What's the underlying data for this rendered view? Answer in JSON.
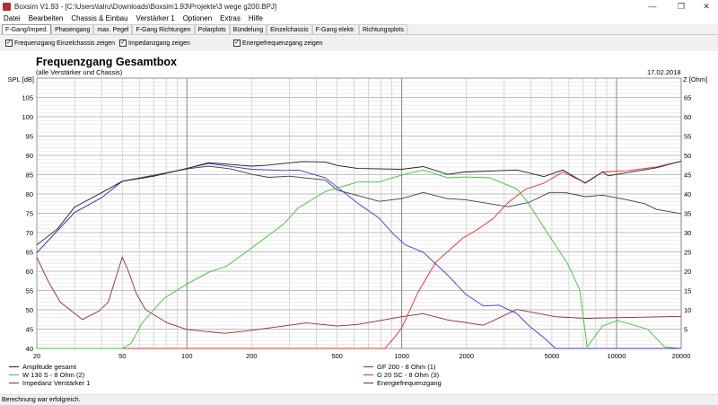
{
  "window": {
    "title": "Boxsim V1.93 - [C:\\Users\\talru\\Downloads\\Boxsim1.93\\Projekte\\3 wege g200.BPJ]",
    "minimize": "—",
    "restore": "❐",
    "close": "✕"
  },
  "menu": [
    "Datei",
    "Bearbeiten",
    "Chassis & Einbau",
    "Verstärker 1",
    "Optionen",
    "Extras",
    "Hilfe"
  ],
  "tabs": [
    "F-Gang/Imped.",
    "Phasengang",
    "max. Pegel",
    "F-Gang Richtungen",
    "Polarplots",
    "Bündelung",
    "Einzelchassis",
    "F-Gang elektr.",
    "Richtungsplots"
  ],
  "options": [
    {
      "label": "Frequenzgang Einzelchassis zeigen",
      "checked": true
    },
    {
      "label": "Impedanzgang zeigen",
      "checked": true
    },
    {
      "label": "Energiefrequenzgang zeigen",
      "checked": true
    }
  ],
  "status": "Berechnung war erfolgreich.",
  "chart_data": {
    "type": "line",
    "title": "Frequenzgang Gesamtbox",
    "subtitle": "(alle Verstärker und Chassis)",
    "date": "17.02.2018",
    "ylabel": "SPL [dB]",
    "y2label": "Z [Ohm]",
    "xscale": "log",
    "xlim": [
      20,
      20000
    ],
    "ylim": [
      40,
      110
    ],
    "y2lim": [
      0,
      70
    ],
    "xticks": [
      20,
      50,
      100,
      200,
      500,
      1000,
      2000,
      5000,
      10000,
      20000
    ],
    "yticks": [
      40,
      45,
      50,
      55,
      60,
      65,
      70,
      75,
      80,
      85,
      90,
      95,
      100,
      105
    ],
    "y2ticks": [
      5,
      10,
      15,
      20,
      25,
      30,
      35,
      40,
      45,
      50,
      55,
      60,
      65
    ],
    "grid": true,
    "legend_position": "bottom",
    "series": [
      {
        "name": "Amplitude gesamt",
        "color": "#202020",
        "axis": "spl",
        "points": [
          [
            20,
            66.8
          ],
          [
            25,
            71
          ],
          [
            30,
            76.6
          ],
          [
            40,
            80.3
          ],
          [
            50,
            83.3
          ],
          [
            70,
            84.6
          ],
          [
            100,
            86.6
          ],
          [
            126,
            88.1
          ],
          [
            200,
            87.2
          ],
          [
            240,
            87.5
          ],
          [
            341,
            88.4
          ],
          [
            440,
            88.3
          ],
          [
            500,
            87.4
          ],
          [
            624,
            86.6
          ],
          [
            1000,
            86.4
          ],
          [
            1260,
            87.1
          ],
          [
            1630,
            85.1
          ],
          [
            1980,
            85.7
          ],
          [
            3440,
            86.2
          ],
          [
            4590,
            84.5
          ],
          [
            5620,
            86.2
          ],
          [
            7150,
            82.8
          ],
          [
            8600,
            85.7
          ],
          [
            9170,
            84.7
          ],
          [
            15350,
            86.8
          ],
          [
            20000,
            88.5
          ]
        ]
      },
      {
        "name": "GF 200 - 8 Ohm (1)",
        "color": "#3a3ad8",
        "axis": "spl",
        "points": [
          [
            20,
            64.8
          ],
          [
            30,
            75.2
          ],
          [
            40,
            79
          ],
          [
            50,
            83.3
          ],
          [
            70,
            84.6
          ],
          [
            100,
            86.6
          ],
          [
            126,
            87.9
          ],
          [
            200,
            86.4
          ],
          [
            282,
            86.1
          ],
          [
            330,
            86.2
          ],
          [
            440,
            84.2
          ],
          [
            624,
            77.6
          ],
          [
            783,
            73.8
          ],
          [
            918,
            69.5
          ],
          [
            1040,
            66.8
          ],
          [
            1260,
            64.9
          ],
          [
            1630,
            59.1
          ],
          [
            1980,
            54.1
          ],
          [
            2400,
            51
          ],
          [
            2840,
            51.2
          ],
          [
            3440,
            49
          ],
          [
            3900,
            45.9
          ],
          [
            4590,
            42.8
          ],
          [
            5200,
            40
          ],
          [
            20000,
            40
          ]
        ]
      },
      {
        "name": "W 130 S - 8 Ohm (2)",
        "color": "#40c040",
        "axis": "spl",
        "points": [
          [
            20,
            40
          ],
          [
            50,
            40
          ],
          [
            55,
            41.3
          ],
          [
            62,
            46.7
          ],
          [
            78,
            52.9
          ],
          [
            100,
            56.7
          ],
          [
            126,
            59.7
          ],
          [
            153,
            61.3
          ],
          [
            200,
            66
          ],
          [
            282,
            72.2
          ],
          [
            330,
            76.4
          ],
          [
            440,
            80.6
          ],
          [
            624,
            83.1
          ],
          [
            783,
            83.1
          ],
          [
            1000,
            84.9
          ],
          [
            1260,
            86.2
          ],
          [
            1630,
            84.2
          ],
          [
            1980,
            84.4
          ],
          [
            2570,
            84.2
          ],
          [
            3440,
            81.3
          ],
          [
            3900,
            77.5
          ],
          [
            4590,
            71.3
          ],
          [
            5900,
            62.1
          ],
          [
            6740,
            55.2
          ],
          [
            7300,
            40.4
          ],
          [
            8600,
            45.8
          ],
          [
            10100,
            47.2
          ],
          [
            13940,
            45
          ],
          [
            16700,
            40.4
          ],
          [
            20000,
            40
          ]
        ]
      },
      {
        "name": "G 20 SC - 8 Ohm (3)",
        "color": "#e03030",
        "axis": "spl",
        "points": [
          [
            20,
            40
          ],
          [
            834,
            40
          ],
          [
            918,
            42.6
          ],
          [
            1000,
            45.3
          ],
          [
            1190,
            54.5
          ],
          [
            1440,
            62.3
          ],
          [
            1920,
            68.5
          ],
          [
            2250,
            70.8
          ],
          [
            2650,
            73.5
          ],
          [
            3130,
            77.8
          ],
          [
            3790,
            81.3
          ],
          [
            4590,
            82.8
          ],
          [
            5620,
            85.7
          ],
          [
            7150,
            82.9
          ],
          [
            8600,
            85.7
          ],
          [
            11140,
            86
          ],
          [
            15350,
            87
          ],
          [
            20000,
            88.5
          ]
        ]
      },
      {
        "name": "Impedanz Verstärker 1",
        "color": "#8b2e2e",
        "axis": "z",
        "points": [
          [
            20,
            23.6
          ],
          [
            22.6,
            17.4
          ],
          [
            25.7,
            12
          ],
          [
            32.6,
            7.5
          ],
          [
            39,
            9.7
          ],
          [
            43,
            12
          ],
          [
            50,
            23.6
          ],
          [
            53,
            20.5
          ],
          [
            58,
            14.3
          ],
          [
            64,
            10.1
          ],
          [
            81,
            6.6
          ],
          [
            100,
            4.9
          ],
          [
            150,
            3.9
          ],
          [
            200,
            4.7
          ],
          [
            282,
            5.8
          ],
          [
            360,
            6.6
          ],
          [
            500,
            5.8
          ],
          [
            624,
            6.2
          ],
          [
            1000,
            8.2
          ],
          [
            1260,
            9
          ],
          [
            1630,
            7.4
          ],
          [
            2400,
            6
          ],
          [
            3440,
            10.1
          ],
          [
            5200,
            8.2
          ],
          [
            7150,
            7.8
          ],
          [
            11140,
            8
          ],
          [
            20000,
            8.3
          ]
        ]
      },
      {
        "name": "Energiefrequenzgang",
        "color": "#404040",
        "axis": "spl",
        "points": [
          [
            20,
            64.8
          ],
          [
            30,
            75.2
          ],
          [
            40,
            79
          ],
          [
            50,
            83.3
          ],
          [
            100,
            86.5
          ],
          [
            126,
            87.2
          ],
          [
            160,
            86.5
          ],
          [
            200,
            85.1
          ],
          [
            240,
            84.3
          ],
          [
            300,
            84.6
          ],
          [
            440,
            83.6
          ],
          [
            500,
            81
          ],
          [
            624,
            79.6
          ],
          [
            783,
            78.1
          ],
          [
            1000,
            78.8
          ],
          [
            1260,
            80.4
          ],
          [
            1630,
            78.8
          ],
          [
            1980,
            78.5
          ],
          [
            3130,
            76.7
          ],
          [
            3900,
            77.8
          ],
          [
            4880,
            80.4
          ],
          [
            5730,
            80.4
          ],
          [
            7150,
            79.3
          ],
          [
            8600,
            79.7
          ],
          [
            11140,
            78.5
          ],
          [
            13530,
            77.5
          ],
          [
            15350,
            76
          ],
          [
            20000,
            74.9
          ]
        ]
      }
    ]
  }
}
